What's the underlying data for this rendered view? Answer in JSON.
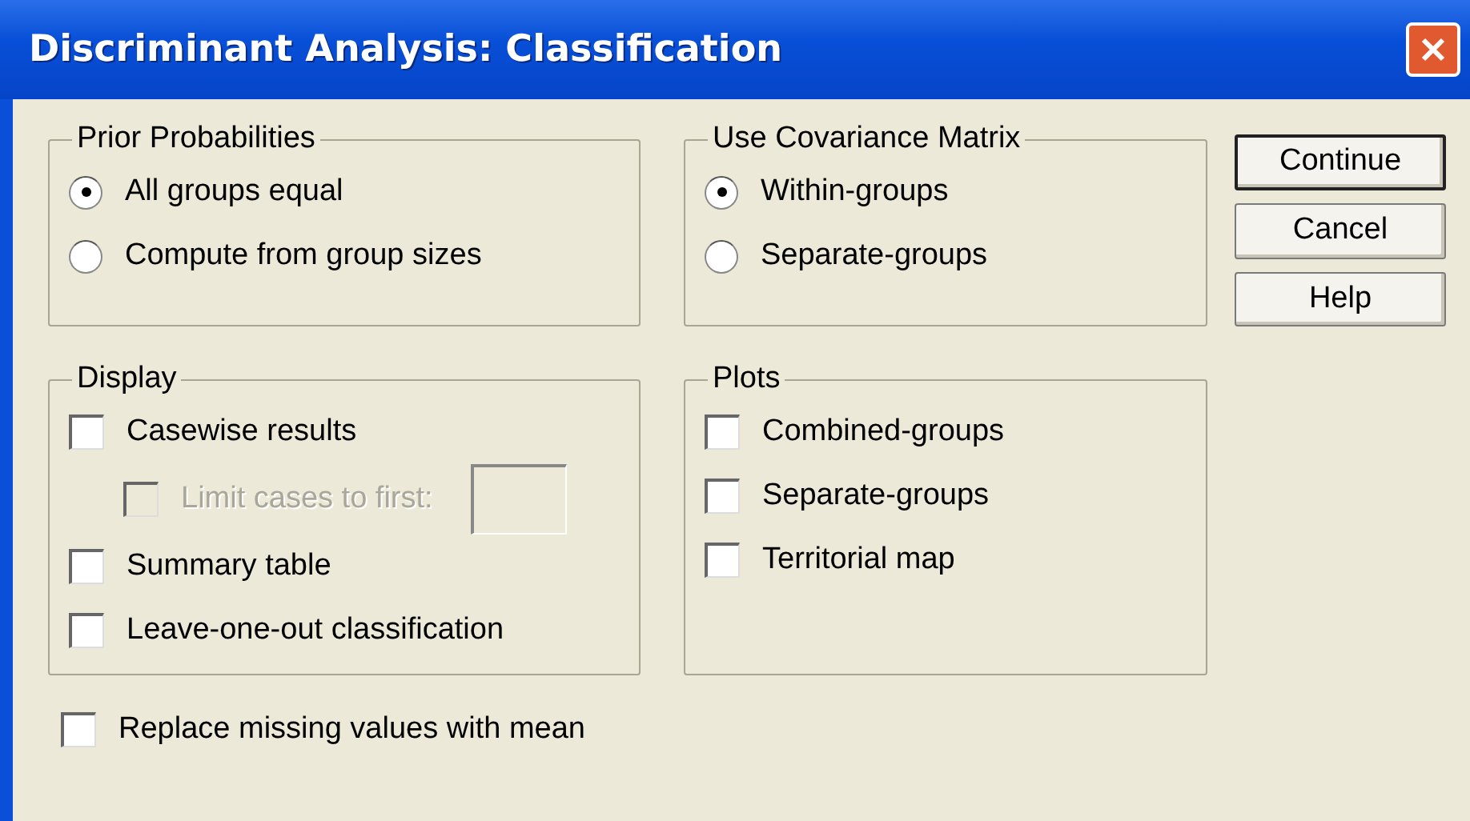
{
  "window": {
    "title": "Discriminant Analysis: Classification"
  },
  "groups": [
    {
      "title": "Prior Probabilities",
      "items": [
        {
          "kind": "radio",
          "label": "All groups equal",
          "selected": true,
          "disabled": false
        },
        {
          "kind": "radio",
          "label": "Compute from group sizes",
          "selected": false,
          "disabled": false
        }
      ]
    },
    {
      "title": "Use Covariance Matrix",
      "items": [
        {
          "kind": "radio",
          "label": "Within-groups",
          "selected": true,
          "disabled": false
        },
        {
          "kind": "radio",
          "label": "Separate-groups",
          "selected": false,
          "disabled": false
        }
      ]
    },
    {
      "title": "Display",
      "items": [
        {
          "kind": "checkbox",
          "label": "Casewise results",
          "checked": false,
          "disabled": false
        },
        {
          "kind": "limit",
          "label": "Limit cases to first:",
          "checked": false,
          "disabled": true
        },
        {
          "kind": "checkbox",
          "label": "Summary table",
          "checked": false,
          "disabled": false
        },
        {
          "kind": "checkbox",
          "label": "Leave-one-out classification",
          "checked": false,
          "disabled": false
        }
      ]
    },
    {
      "title": "Plots",
      "items": [
        {
          "kind": "checkbox",
          "label": "Combined-groups",
          "checked": false,
          "disabled": false
        },
        {
          "kind": "checkbox",
          "label": "Separate-groups",
          "checked": false,
          "disabled": false
        },
        {
          "kind": "checkbox",
          "label": "Territorial map",
          "checked": false,
          "disabled": false
        }
      ]
    }
  ],
  "buttons": [
    {
      "label": "Continue",
      "default": true
    },
    {
      "label": "Cancel",
      "default": false
    },
    {
      "label": "Help",
      "default": false
    }
  ],
  "bottom_option": {
    "label": "Replace missing values with mean",
    "checked": false
  }
}
